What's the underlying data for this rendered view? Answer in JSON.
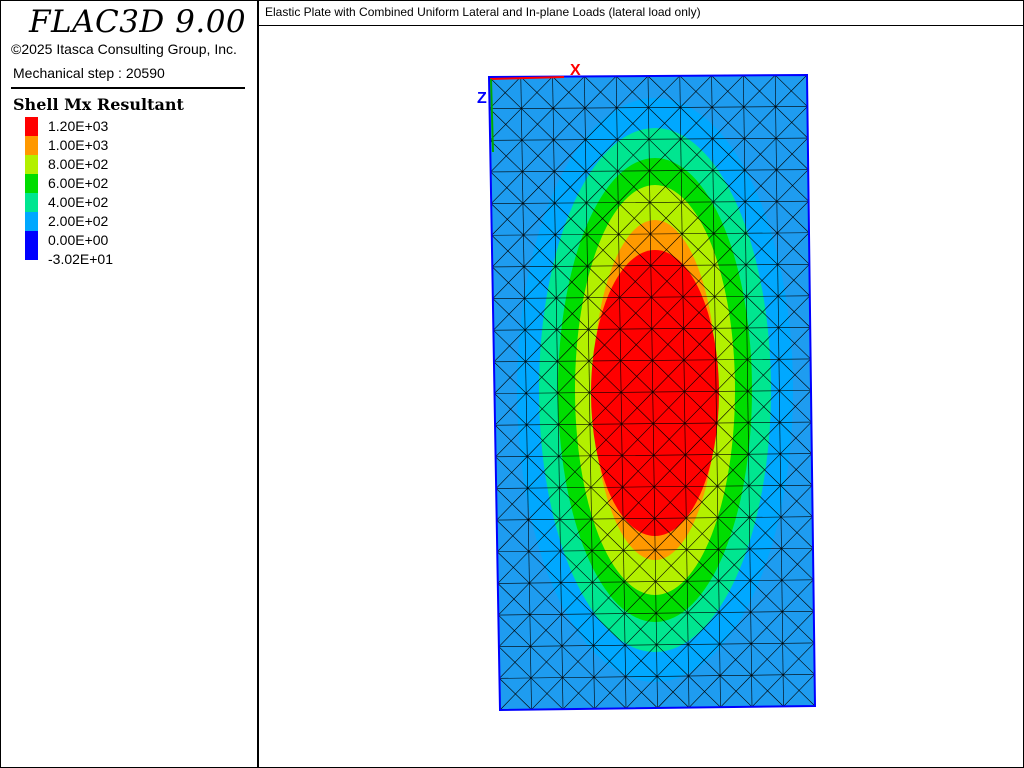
{
  "app": {
    "title": "FLAC3D 9.00",
    "copyright": "©2025 Itasca Consulting Group, Inc.",
    "step_label": "Mechanical step : 20590"
  },
  "legend": {
    "title": "Shell Mx Resultant",
    "items": [
      {
        "label": "1.20E+03",
        "color": "#ff0000"
      },
      {
        "label": "1.00E+03",
        "color": "#ff9900"
      },
      {
        "label": "8.00E+02",
        "color": "#b3f000"
      },
      {
        "label": "6.00E+02",
        "color": "#00dd00"
      },
      {
        "label": "4.00E+02",
        "color": "#00e690"
      },
      {
        "label": "2.00E+02",
        "color": "#00a8ff"
      },
      {
        "label": "0.00E+00",
        "color": "#0000ff"
      },
      {
        "label": "-3.02E+01",
        "color": "#0000ff"
      }
    ]
  },
  "plot": {
    "title": "Elastic Plate with Combined Uniform Lateral and In-plane Loads (lateral load only)",
    "axis_x_label": "X",
    "axis_z_label": "Z",
    "axis_x_color": "#ff0000",
    "axis_z_color": "#0000ff"
  }
}
